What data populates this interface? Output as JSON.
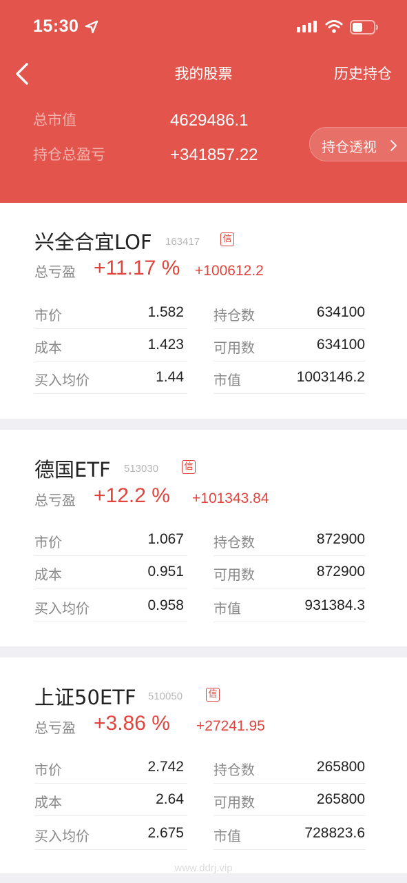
{
  "status_bar": {
    "time": "15:30"
  },
  "nav": {
    "title": "我的股票",
    "history": "历史持仓"
  },
  "summary": {
    "market_value_label": "总市值",
    "market_value": "4629486.1",
    "total_pl_label": "持仓总盈亏",
    "total_pl": "+341857.22",
    "analysis_button": "持仓透视"
  },
  "badge_text": "信",
  "stocks": [
    {
      "name": "兴全合宜LOF",
      "code": "163417",
      "pl_label": "总亏盈",
      "pl_pct": "+11.17 %",
      "pl_amount": "+100612.2",
      "left": [
        {
          "label": "市价",
          "value": "1.582"
        },
        {
          "label": "成本",
          "value": "1.423"
        },
        {
          "label": "买入均价",
          "value": "1.44"
        }
      ],
      "right": [
        {
          "label": "持仓数",
          "value": "634100"
        },
        {
          "label": "可用数",
          "value": "634100"
        },
        {
          "label": "市值",
          "value": "1003146.2"
        }
      ]
    },
    {
      "name": "德国ETF",
      "code": "513030",
      "pl_label": "总亏盈",
      "pl_pct": "+12.2 %",
      "pl_amount": "+101343.84",
      "left": [
        {
          "label": "市价",
          "value": "1.067"
        },
        {
          "label": "成本",
          "value": "0.951"
        },
        {
          "label": "买入均价",
          "value": "0.958"
        }
      ],
      "right": [
        {
          "label": "持仓数",
          "value": "872900"
        },
        {
          "label": "可用数",
          "value": "872900"
        },
        {
          "label": "市值",
          "value": "931384.3"
        }
      ]
    },
    {
      "name": "上证50ETF",
      "code": "510050",
      "pl_label": "总亏盈",
      "pl_pct": "+3.86 %",
      "pl_amount": "+27241.95",
      "left": [
        {
          "label": "市价",
          "value": "2.742"
        },
        {
          "label": "成本",
          "value": "2.64"
        },
        {
          "label": "买入均价",
          "value": "2.675"
        }
      ],
      "right": [
        {
          "label": "持仓数",
          "value": "265800"
        },
        {
          "label": "可用数",
          "value": "265800"
        },
        {
          "label": "市值",
          "value": "728823.6"
        }
      ]
    }
  ],
  "watermark": "www.ddrj.vip",
  "colors": {
    "header": "#e3554c",
    "positive": "#e0443c",
    "background": "#efeff4"
  }
}
